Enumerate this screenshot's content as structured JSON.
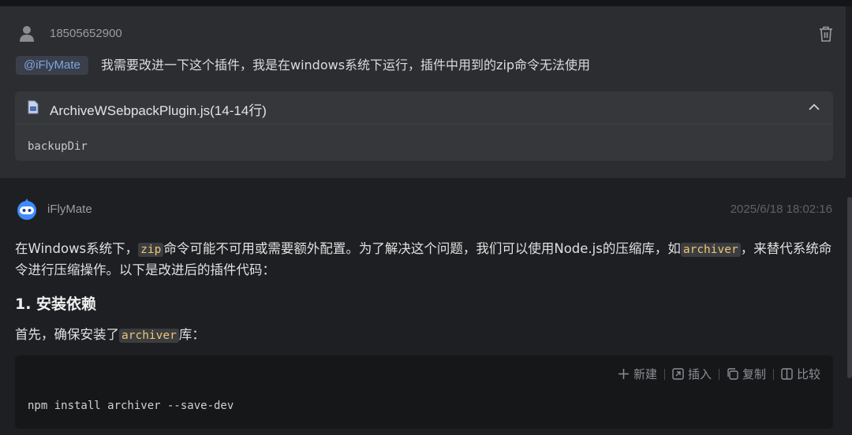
{
  "user_message": {
    "username": "18505652900",
    "mention": "@iFlyMate",
    "text": "我需要改进一下这个插件，我是在windows系统下运行，插件中用到的zip命令无法使用",
    "attachment": {
      "file_name": "ArchiveWSebpackPlugin.js(14-14行)",
      "code": "backupDir"
    }
  },
  "bot_message": {
    "name": "iFlyMate",
    "timestamp": "2025/6/18 18:02:16",
    "paragraph1": {
      "t1": "在Windows系统下，",
      "code1": "zip",
      "t2": "命令可能不可用或需要额外配置。为了解决这个问题，我们可以使用Node.js的压缩库，如",
      "code2": "archiver",
      "t3": "，来替代系统命令进行压缩操作。以下是改进后的插件代码："
    },
    "heading": "1. 安装依赖",
    "paragraph2": {
      "t1": "首先，确保安装了",
      "code1": "archiver",
      "t2": "库："
    },
    "code_block": {
      "code": "npm install archiver --save-dev",
      "tools": {
        "new": "新建",
        "insert": "插入",
        "copy": "复制",
        "compare": "比较"
      }
    }
  },
  "icons": [
    "user-icon",
    "trash-icon",
    "file-icon",
    "chevron-up-icon",
    "bot-avatar-icon",
    "plus-icon",
    "insert-icon",
    "copy-icon",
    "compare-icon"
  ],
  "colors": {
    "background": "#1e1f22",
    "user_block": "#2b2d30",
    "mention_text": "#7fa6e0",
    "inline_code": "#f0c674"
  }
}
